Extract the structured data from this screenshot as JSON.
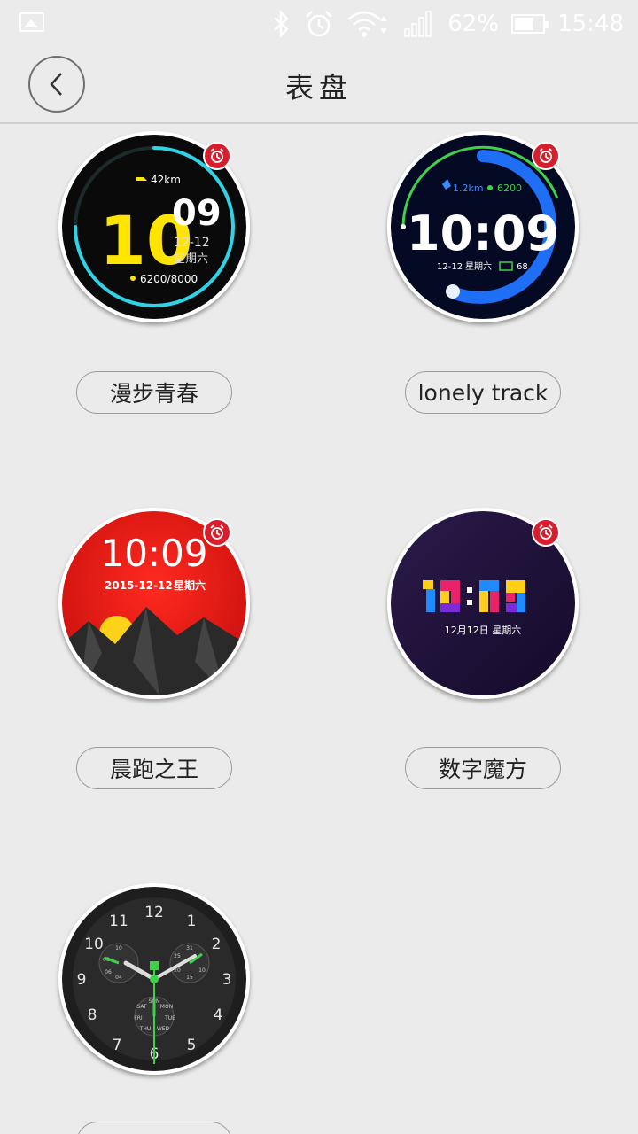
{
  "status_bar": {
    "battery": "62%",
    "time": "15:48"
  },
  "header": {
    "title": "表盘"
  },
  "watch_faces": [
    {
      "name": "漫步青春",
      "distance": "42km",
      "hour": "10",
      "minute": "09",
      "date": "12-12",
      "weekday": "星期六",
      "steps": "6200/8000"
    },
    {
      "name": "lonely track",
      "distance": "1.2km",
      "steps": "6200",
      "time": "10:09",
      "date": "12-12",
      "weekday": "星期六",
      "battery": "68"
    },
    {
      "name": "晨跑之王",
      "time": "10:09",
      "date": "2015-12-12",
      "weekday": "星期六"
    },
    {
      "name": "数字魔方",
      "time": "10:09",
      "date": "12月12日 星期六"
    },
    {
      "name": "",
      "numerals": [
        "12",
        "1",
        "2",
        "3",
        "4",
        "5",
        "6",
        "7",
        "8",
        "9",
        "10",
        "11"
      ],
      "sub_dials": {
        "left": [
          "10",
          "08",
          "06",
          "04"
        ],
        "right": [
          "31",
          "25",
          "20",
          "15",
          "10"
        ],
        "bottom": [
          "SUN",
          "MON",
          "TUE",
          "WED",
          "THU",
          "FRI",
          "SAT"
        ]
      }
    }
  ],
  "colors": {
    "badge": "#d81e2c",
    "accent_cyan": "#2fd3e6",
    "accent_yellow": "#ffe400",
    "accent_blue": "#1e6ff5",
    "accent_green": "#3fd14a"
  }
}
